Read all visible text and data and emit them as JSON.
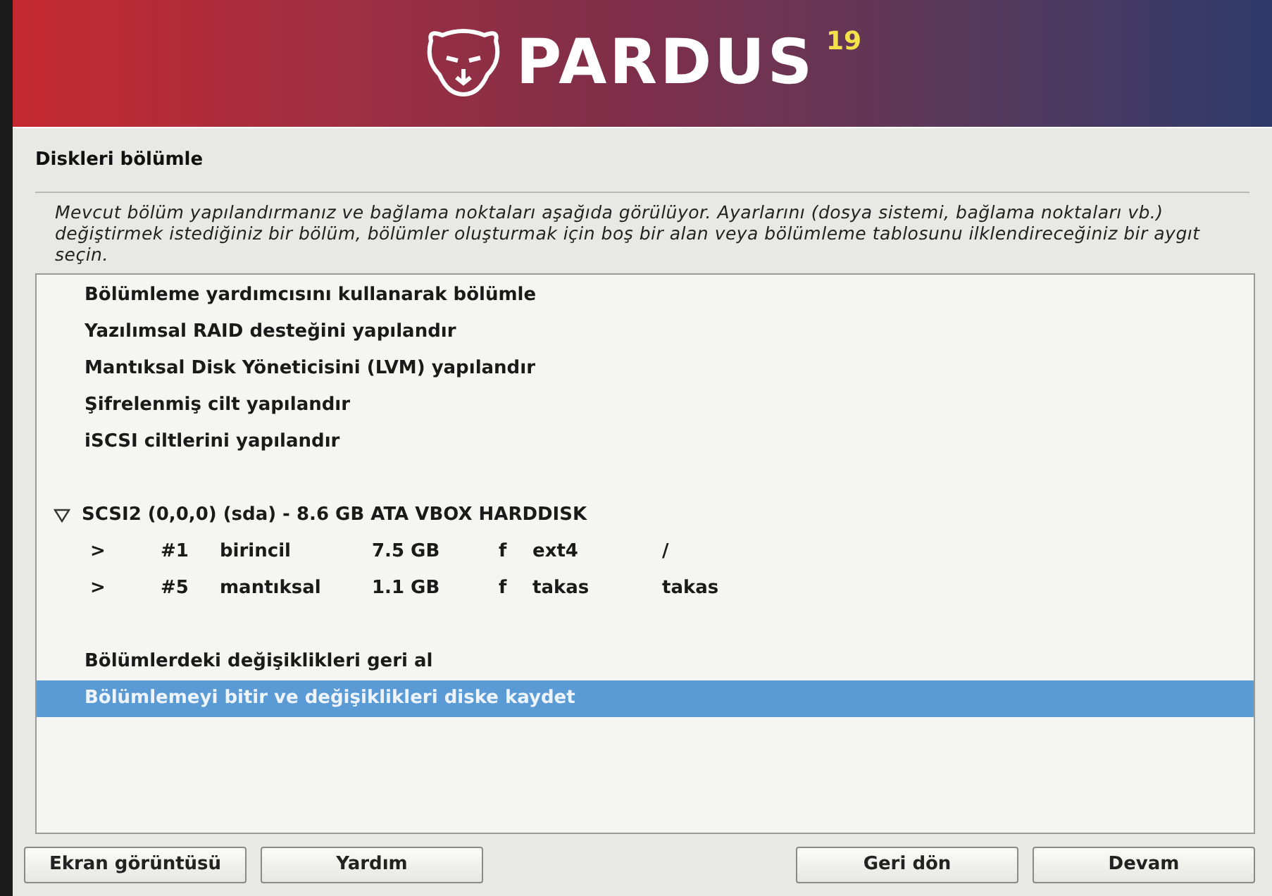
{
  "banner": {
    "logo_text": "PARDUS",
    "version": "19"
  },
  "title": "Diskleri bölümle",
  "description": "Mevcut bölüm yapılandırmanız ve bağlama noktaları aşağıda görülüyor. Ayarlarını (dosya sistemi, bağlama noktaları vb.) değiştirmek istediğiniz bir bölüm, bölümler oluşturmak için boş bir alan veya bölümleme tablosunu ilklendireceğiniz bir aygıt seçin.",
  "list": [
    {
      "kind": "action",
      "label": "Bölümleme yardımcısını kullanarak bölümle",
      "selected": false
    },
    {
      "kind": "action",
      "label": "Yazılımsal RAID desteğini yapılandır",
      "selected": false
    },
    {
      "kind": "action",
      "label": "Mantıksal Disk Yöneticisini (LVM) yapılandır",
      "selected": false
    },
    {
      "kind": "action",
      "label": "Şifrelenmiş cilt yapılandır",
      "selected": false
    },
    {
      "kind": "action",
      "label": "iSCSI ciltlerini yapılandır",
      "selected": false
    },
    {
      "kind": "spacer"
    },
    {
      "kind": "disk",
      "label": "SCSI2 (0,0,0) (sda) - 8.6 GB ATA VBOX HARDDISK",
      "expanded": true,
      "selected": false,
      "children": [
        {
          "marker": ">",
          "number": "#1",
          "type": "birincil",
          "size": "7.5 GB",
          "flag": "f",
          "filesystem": "ext4",
          "mount": "/",
          "selected": false
        },
        {
          "marker": ">",
          "number": "#5",
          "type": "mantıksal",
          "size": "1.1 GB",
          "flag": "f",
          "filesystem": "takas",
          "mount": "takas",
          "selected": false
        }
      ]
    },
    {
      "kind": "spacer"
    },
    {
      "kind": "action",
      "label": "Bölümlerdeki değişiklikleri geri al",
      "selected": false
    },
    {
      "kind": "action",
      "label": "Bölümlemeyi bitir ve değişiklikleri diske kaydet",
      "selected": true
    }
  ],
  "buttons_left": [
    "Ekran görüntüsü",
    "Yardım"
  ],
  "buttons_right": [
    "Geri dön",
    "Devam"
  ]
}
